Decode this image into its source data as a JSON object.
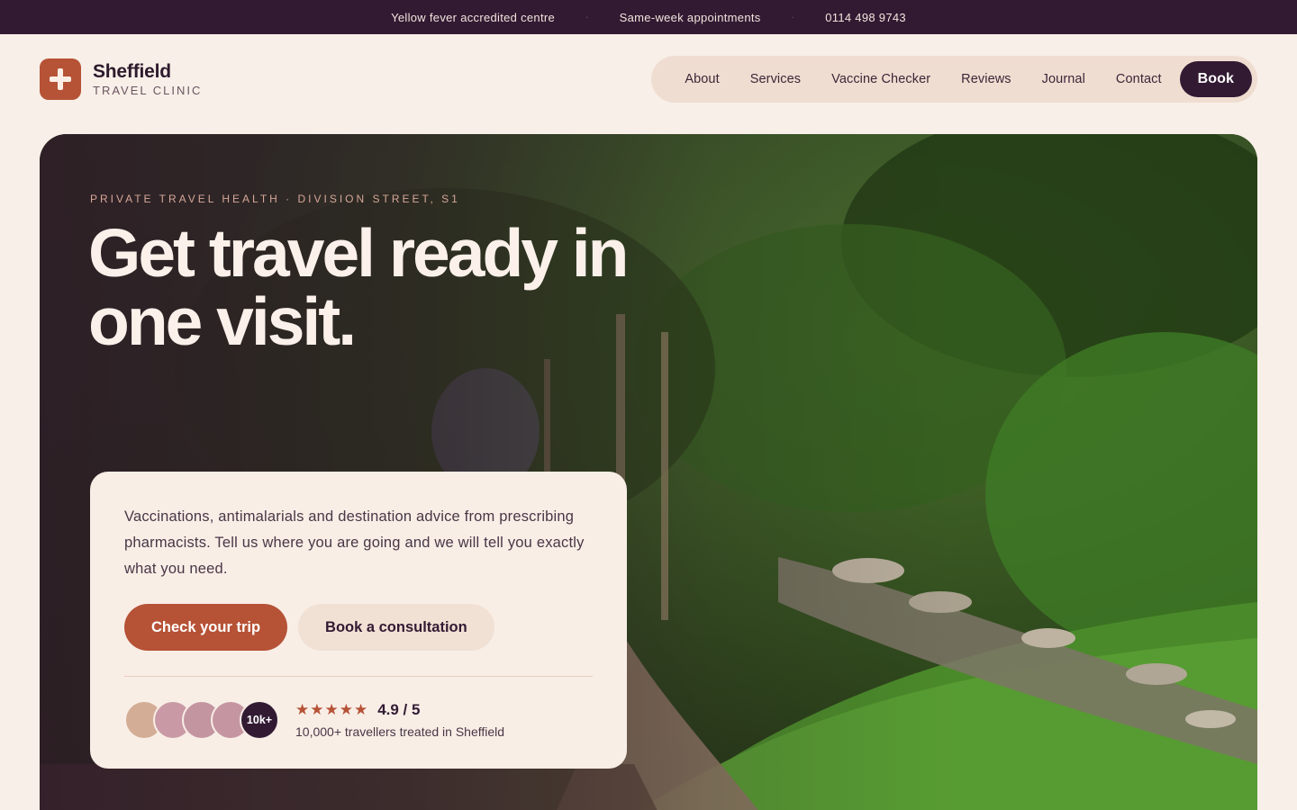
{
  "topbar": {
    "item1": "Yellow fever accredited centre",
    "item2": "Same-week appointments",
    "item3": "0114 498 9743",
    "separator": "·"
  },
  "brand": {
    "name": "Sheffield",
    "subtitle": "TRAVEL CLINIC",
    "logo_icon": "plus-icon"
  },
  "nav": {
    "items": [
      "About",
      "Services",
      "Vaccine Checker",
      "Reviews",
      "Journal",
      "Contact"
    ],
    "book_label": "Book"
  },
  "hero": {
    "eyebrow": "PRIVATE TRAVEL HEALTH · DIVISION STREET, S1",
    "headline_line1": "Get travel ready in",
    "headline_line2": "one visit.",
    "description": "Vaccinations, antimalarials and destination advice from prescribing pharmacists. Tell us where you are going and we will tell you exactly what you need.",
    "primary_cta": "Check your trip",
    "secondary_cta": "Book a consultation",
    "avatar_count": "10k+",
    "stars": "★★★★★",
    "rating": "4.9 / 5",
    "proof_text": "10,000+ travellers treated in Sheffield"
  },
  "colors": {
    "accent": "#b65236",
    "dark": "#321a33",
    "background": "#f8efe8",
    "avatar1": "#d4ad97",
    "avatar2": "#c99aa6",
    "avatar3": "#c395a1",
    "avatar4": "#c596a2"
  }
}
